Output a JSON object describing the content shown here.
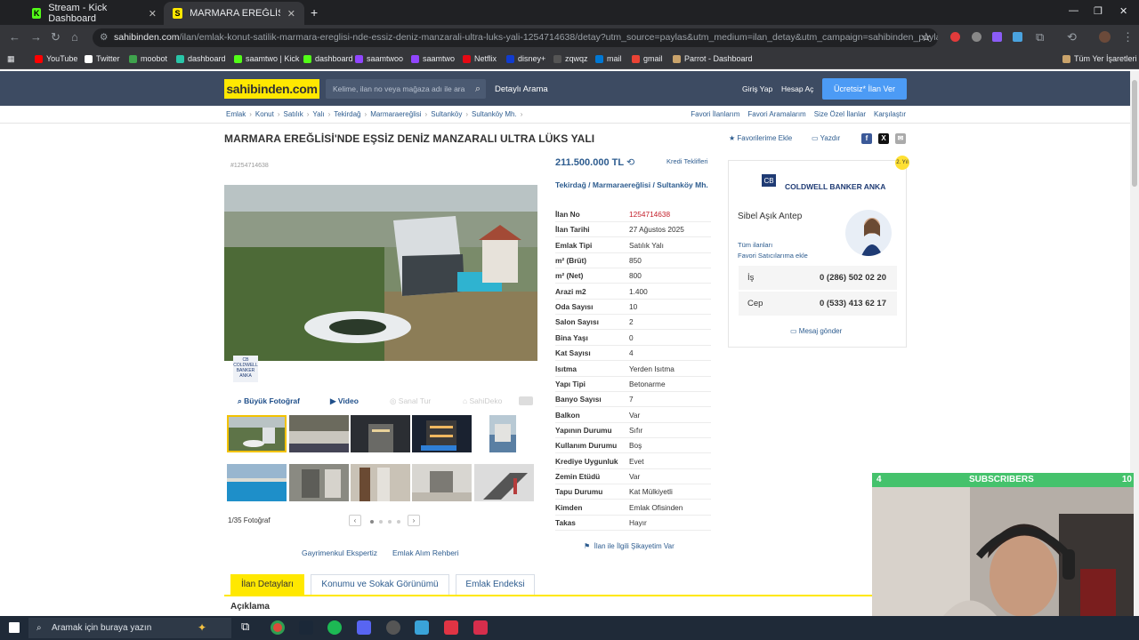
{
  "browser": {
    "tabs": [
      {
        "title": "Stream - Kick Dashboard",
        "favicon": "K",
        "color": "#53fc18",
        "active": false
      },
      {
        "title": "MARMARA EREĞLİSİ'NDE EŞSİZ",
        "favicon": "S",
        "color": "#ffe800",
        "active": true
      }
    ],
    "url_host": "sahibinden.com",
    "url_path": "/ilan/emlak-konut-satilik-marmara-ereglisi-nde-essiz-deniz-manzarali-ultra-luks-yali-1254714638/detay?utm_source=paylas&utm_medium=ilan_detay&utm_campaign=sahibinden_paylas&utm_conten...",
    "bookmarks": [
      "YouTube",
      "Twitter",
      "moobot",
      "dashboard",
      "saamtwo | Kick",
      "dashboard",
      "saamtwoo",
      "saamtwo",
      "Netflix",
      "disney+",
      "zqwqz",
      "mail",
      "gmail",
      "Parrot - Dashboard"
    ],
    "all_bookmarks": "Tüm Yer İşaretleri"
  },
  "site": {
    "logo": "sahibinden.com",
    "search_placeholder": "Kelime, ilan no veya mağaza adı ile ara",
    "detailed_search": "Detaylı Arama",
    "login": "Giriş Yap",
    "signup": "Hesap Aç",
    "post_ad": "Ücretsiz* İlan Ver",
    "breadcrumbs": [
      "Emlak",
      "Konut",
      "Satılık",
      "Yalı",
      "Tekirdağ",
      "Marmaraereğlisi",
      "Sultanköy",
      "Sultanköy Mh."
    ],
    "right_links": [
      "Favori İlanlarım",
      "Favori Aramalarım",
      "Size Özel İlanlar",
      "Karşılaştır"
    ]
  },
  "listing": {
    "title": "MARMARA EREĞLİSİ'NDE EŞSİZ DENİZ MANZARALI ULTRA LÜKS YALI",
    "add_favorite": "Favorilerime Ekle",
    "print": "Yazdır",
    "ad_id_label": "#1254714638",
    "price": "211.500.000 TL",
    "credit_offers": "Kredi Teklifleri",
    "location": "Tekirdağ  /  Marmaraereğlisi  /  Sultanköy Mh.",
    "gallery_buttons": {
      "big_photo": "Büyük Fotoğraf",
      "video": "Video",
      "virtual_tour": "Sanal Tur",
      "sahideko": "SahiDeko"
    },
    "photo_count": "1/35 Fotoğraf",
    "expert_link": "Gayrimenkul Ekspertiz",
    "guide_link": "Emlak Alım Rehberi",
    "complaint": "İlan ile İlgili Şikayetim Var",
    "details": [
      {
        "k": "İlan No",
        "v": "1254714638",
        "red": true
      },
      {
        "k": "İlan Tarihi",
        "v": "27 Ağustos 2025"
      },
      {
        "k": "Emlak Tipi",
        "v": "Satılık Yalı"
      },
      {
        "k": "m² (Brüt)",
        "v": "850"
      },
      {
        "k": "m² (Net)",
        "v": "800"
      },
      {
        "k": "Arazi m2",
        "v": "1.400"
      },
      {
        "k": "Oda Sayısı",
        "v": "10"
      },
      {
        "k": "Salon Sayısı",
        "v": "2"
      },
      {
        "k": "Bina Yaşı",
        "v": "0"
      },
      {
        "k": "Kat Sayısı",
        "v": "4"
      },
      {
        "k": "Isıtma",
        "v": "Yerden Isıtma"
      },
      {
        "k": "Yapı Tipi",
        "v": "Betonarme"
      },
      {
        "k": "Banyo Sayısı",
        "v": "7"
      },
      {
        "k": "Balkon",
        "v": "Var"
      },
      {
        "k": "Yapının Durumu",
        "v": "Sıfır"
      },
      {
        "k": "Kullanım Durumu",
        "v": "Boş"
      },
      {
        "k": "Krediye Uygunluk",
        "v": "Evet"
      },
      {
        "k": "Zemin Etüdü",
        "v": "Var"
      },
      {
        "k": "Tapu Durumu",
        "v": "Kat Mülkiyetli"
      },
      {
        "k": "Kimden",
        "v": "Emlak Ofisinden"
      },
      {
        "k": "Takas",
        "v": "Hayır"
      }
    ],
    "tabs": [
      "İlan Detayları",
      "Konumu ve Sokak Görünümü",
      "Emlak Endeksi"
    ],
    "description_heading": "Açıklama"
  },
  "agent": {
    "company": "COLDWELL BANKER ANKA",
    "name": "Sibel Aşık Antep",
    "all_listings": "Tüm ilanları",
    "add_fav_seller": "Favori Satıcılarıma ekle",
    "phones": [
      {
        "label": "İş",
        "number": "0 (286) 502 02 20"
      },
      {
        "label": "Cep",
        "number": "0 (533) 413 62 17"
      }
    ],
    "send_message": "Mesaj gönder",
    "badge": "2. Yıl"
  },
  "overlay": {
    "left": "4",
    "label": "SUBSCRIBERS",
    "right": "10",
    "color": "#45c26c"
  },
  "taskbar": {
    "search_placeholder": "Aramak için buraya yazın"
  }
}
